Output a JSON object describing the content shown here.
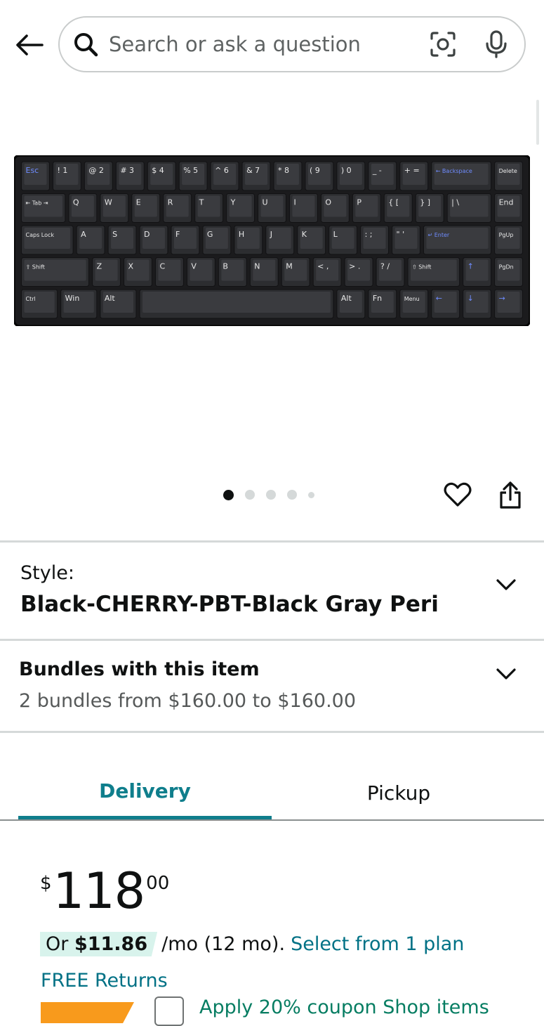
{
  "header": {
    "search_placeholder": "Search or ask a question",
    "icons": [
      "back-arrow-icon",
      "search-icon",
      "camera-icon",
      "mic-icon"
    ]
  },
  "product_image": {
    "keyboard_rows": [
      [
        "Esc",
        "! 1",
        "@ 2",
        "# 3",
        "$ 4",
        "% 5",
        "^ 6",
        "& 7",
        "* 8",
        "( 9",
        ") 0",
        "_ -",
        "+ =",
        "← Backspace",
        "Delete"
      ],
      [
        "⇤ Tab ⇥",
        "Q",
        "W",
        "E",
        "R",
        "T",
        "Y",
        "U",
        "I",
        "O",
        "P",
        "{ [",
        "} ]",
        "| \\",
        "End"
      ],
      [
        "Caps Lock",
        "A",
        "S",
        "D",
        "F",
        "G",
        "H",
        "J",
        "K",
        "L",
        ": ;",
        "\" '",
        "↵ Enter",
        "PgUp"
      ],
      [
        "⇧ Shift",
        "Z",
        "X",
        "C",
        "V",
        "B",
        "N",
        "M",
        "< ,",
        "> .",
        "? /",
        "⇧ Shift",
        "↑",
        "PgDn"
      ],
      [
        "Ctrl",
        "Win",
        "Alt",
        "",
        "Alt",
        "Fn",
        "Menu",
        "←",
        "↓",
        "→"
      ]
    ]
  },
  "carousel": {
    "count": 5,
    "active_index": 0
  },
  "style": {
    "label": "Style:",
    "value": "Black-CHERRY-PBT-Black Gray Peri"
  },
  "bundles": {
    "title": "Bundles with this item",
    "subtitle": "2 bundles from $160.00 to $160.00"
  },
  "tabs": [
    {
      "label": "Delivery",
      "active": true
    },
    {
      "label": "Pickup",
      "active": false
    }
  ],
  "price": {
    "symbol": "$",
    "whole": "118",
    "fraction": "00"
  },
  "plan": {
    "prefix": "Or ",
    "monthly": "$11.86",
    "rest": "/mo (12 mo).",
    "link": "Select from 1 plan"
  },
  "returns": {
    "label": "FREE Returns"
  },
  "coupon": {
    "text": "Apply 20% coupon  Shop items"
  },
  "colors": {
    "accent_teal": "#0f7e8c",
    "link": "#007185",
    "coupon_badge": "#f89a1c",
    "coupon_text": "#067d62"
  }
}
